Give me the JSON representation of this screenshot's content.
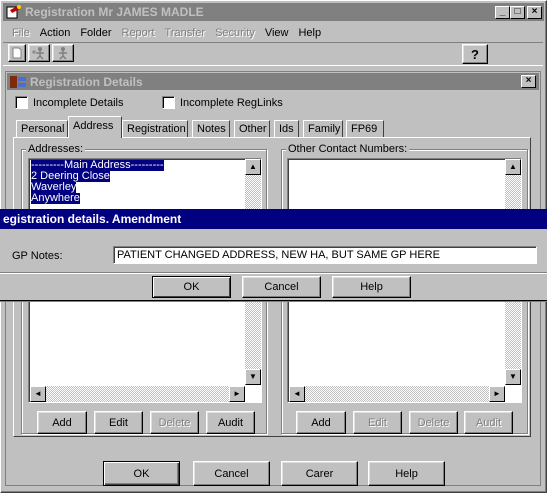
{
  "window": {
    "title": "Registration Mr JAMES MADLE"
  },
  "menu": [
    {
      "label": "File",
      "enabled": false
    },
    {
      "label": "Action",
      "enabled": true
    },
    {
      "label": "Folder",
      "enabled": true
    },
    {
      "label": "Report",
      "enabled": false
    },
    {
      "label": "Transfer",
      "enabled": false
    },
    {
      "label": "Security",
      "enabled": false
    },
    {
      "label": "View",
      "enabled": true
    },
    {
      "label": "Help",
      "enabled": true
    }
  ],
  "toolbar": {
    "help_icon": "?"
  },
  "details": {
    "title": "Registration Details",
    "incomplete_details_label": "Incomplete Details",
    "incomplete_reglinks_label": "Incomplete RegLinks",
    "tabs": [
      "Personal",
      "Address",
      "Registration",
      "Notes",
      "Other",
      "Ids",
      "Family",
      "FP69"
    ],
    "active_tab": "Address",
    "addresses_label": "Addresses:",
    "other_contact_label": "Other Contact Numbers:",
    "address_lines": [
      "---------Main Address---------",
      "2 Deering Close",
      "Waverley",
      "Anywhere"
    ],
    "left_buttons": {
      "add": "Add",
      "edit": "Edit",
      "delete": "Delete",
      "audit": "Audit"
    },
    "right_buttons": {
      "add": "Add",
      "edit": "Edit",
      "delete": "Delete",
      "audit": "Audit"
    }
  },
  "amendment": {
    "title": "egistration details. Amendment",
    "gp_notes_label": "GP Notes:",
    "gp_notes_value": "PATIENT CHANGED ADDRESS, NEW HA, BUT SAME GP HERE",
    "ok": "OK",
    "cancel": "Cancel",
    "help": "Help"
  },
  "footer": {
    "ok": "OK",
    "cancel": "Cancel",
    "carer": "Carer",
    "help": "Help"
  }
}
